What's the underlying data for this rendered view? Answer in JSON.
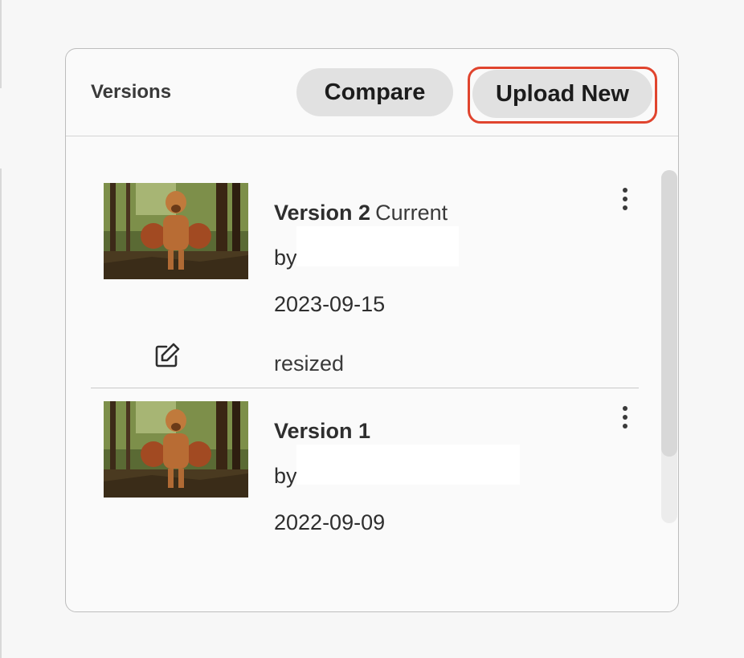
{
  "panel": {
    "title": "Versions",
    "compare_label": "Compare",
    "upload_label": "Upload New"
  },
  "versions": [
    {
      "name": "Version 2",
      "status": "Current",
      "by_label": "by",
      "date": "2023-09-15",
      "comment": "resized",
      "thumbnail_icon": "dog-hiking-photo",
      "menu_icon": "more-vertical-icon",
      "comment_icon": "edit-icon"
    },
    {
      "name": "Version 1",
      "status": "",
      "by_label": "by",
      "date": "2022-09-09",
      "thumbnail_icon": "dog-hiking-photo",
      "menu_icon": "more-vertical-icon"
    }
  ],
  "colors": {
    "focus_ring": "#e0442e",
    "button_bg": "#e1e1e1",
    "panel_border": "#bdbdbd"
  }
}
